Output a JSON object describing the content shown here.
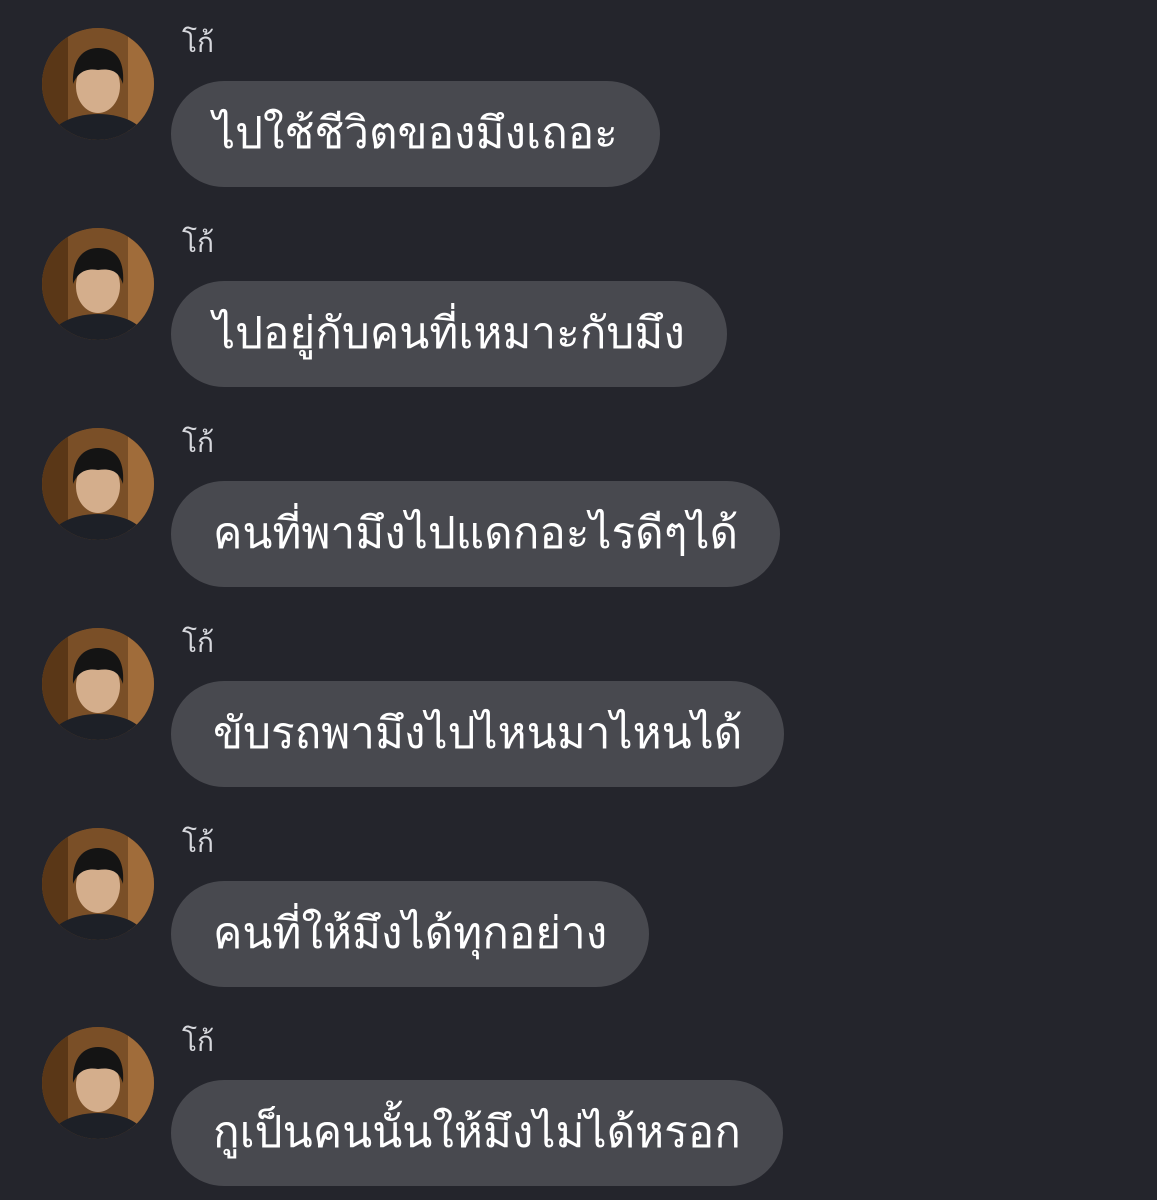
{
  "messages": [
    {
      "sender": "โก้",
      "text": "ไปใช้ชีวิตของมึงเถอะ"
    },
    {
      "sender": "โก้",
      "text": "ไปอยู่กับคนที่เหมาะกับมึง"
    },
    {
      "sender": "โก้",
      "text": "คนที่พามึงไปแดกอะไรดีๆได้"
    },
    {
      "sender": "โก้",
      "text": "ขับรถพามึงไปไหนมาไหนได้"
    },
    {
      "sender": "โก้",
      "text": "คนที่ให้มึงได้ทุกอย่าง"
    },
    {
      "sender": "โก้",
      "text": "กูเป็นคนนั้นให้มึงไม่ได้หรอก"
    }
  ],
  "colors": {
    "background": "#24252c",
    "bubble": "#48494f",
    "bubble_text": "#ffffff",
    "sender_text": "#d6d7dc"
  }
}
